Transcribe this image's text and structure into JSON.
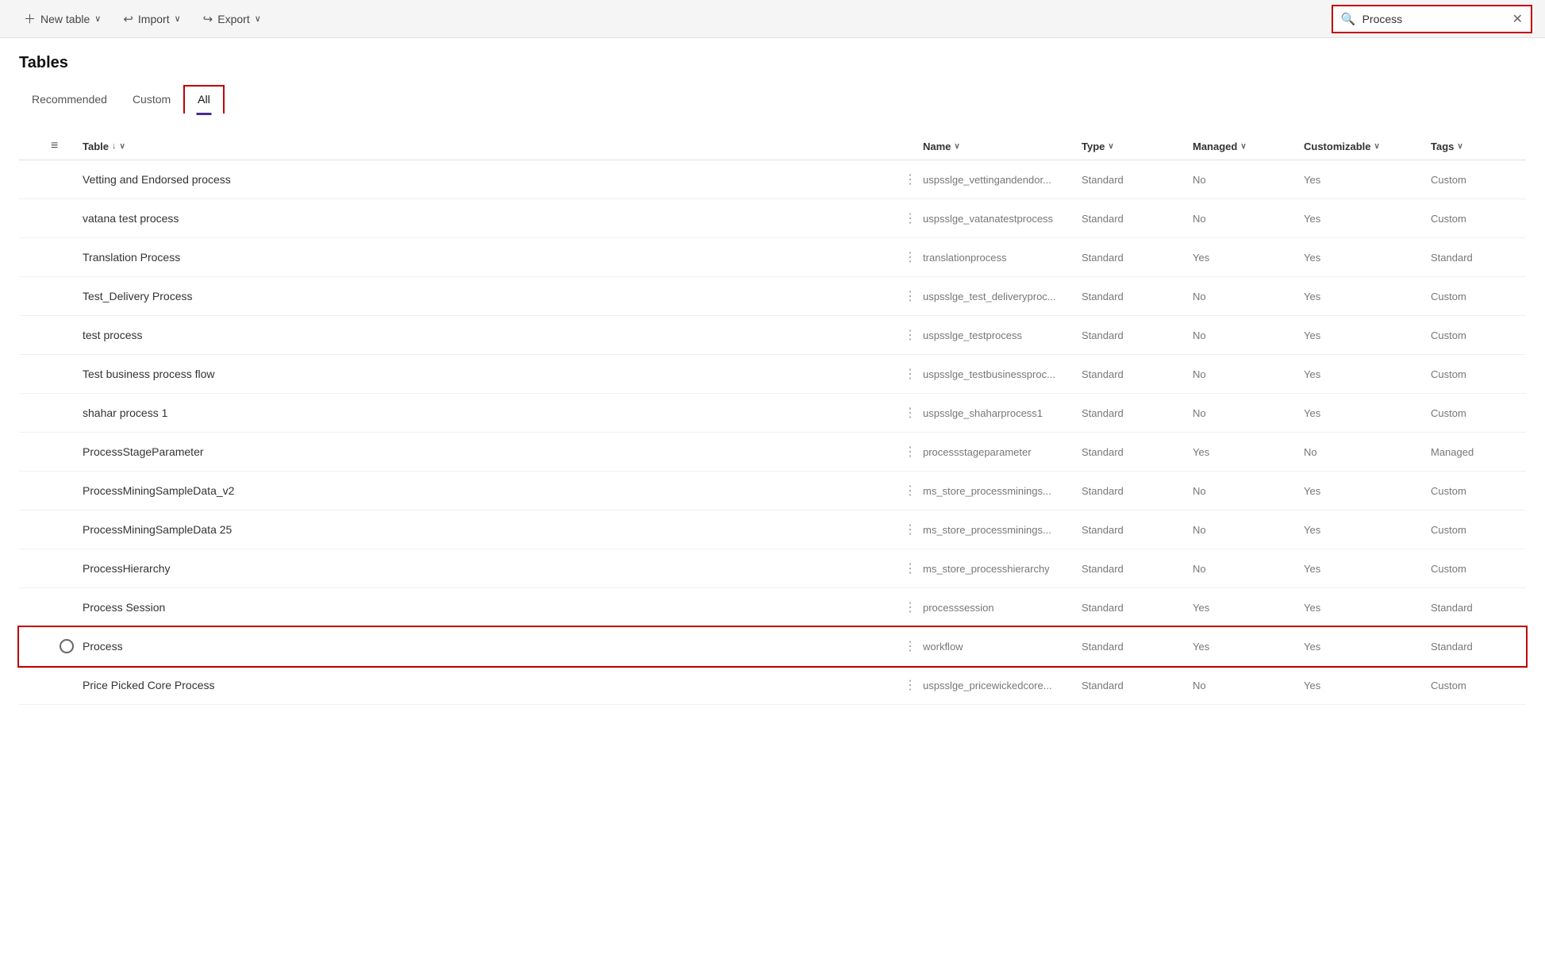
{
  "toolbar": {
    "new_table_label": "New table",
    "import_label": "Import",
    "export_label": "Export",
    "search_placeholder": "Process",
    "search_value": "Process"
  },
  "page": {
    "title": "Tables"
  },
  "tabs": [
    {
      "id": "recommended",
      "label": "Recommended",
      "active": false
    },
    {
      "id": "custom",
      "label": "Custom",
      "active": false
    },
    {
      "id": "all",
      "label": "All",
      "active": true
    }
  ],
  "table": {
    "columns": [
      {
        "id": "table",
        "label": "Table",
        "sort": "↓",
        "chevron": "∨"
      },
      {
        "id": "name",
        "label": "Name",
        "sort": "",
        "chevron": "∨"
      },
      {
        "id": "type",
        "label": "Type",
        "sort": "",
        "chevron": "∨"
      },
      {
        "id": "managed",
        "label": "Managed",
        "sort": "",
        "chevron": "∨"
      },
      {
        "id": "customizable",
        "label": "Customizable",
        "sort": "",
        "chevron": "∨"
      },
      {
        "id": "tags",
        "label": "Tags",
        "sort": "",
        "chevron": "∨"
      }
    ],
    "rows": [
      {
        "id": 1,
        "table": "Vetting and Endorsed process",
        "name": "uspsslge_vettingandendor...",
        "type": "Standard",
        "managed": "No",
        "customizable": "Yes",
        "tags": "Custom",
        "selected": false,
        "radio": false
      },
      {
        "id": 2,
        "table": "vatana test process",
        "name": "uspsslge_vatanatestprocess",
        "type": "Standard",
        "managed": "No",
        "customizable": "Yes",
        "tags": "Custom",
        "selected": false,
        "radio": false
      },
      {
        "id": 3,
        "table": "Translation Process",
        "name": "translationprocess",
        "type": "Standard",
        "managed": "Yes",
        "customizable": "Yes",
        "tags": "Standard",
        "selected": false,
        "radio": false
      },
      {
        "id": 4,
        "table": "Test_Delivery Process",
        "name": "uspsslge_test_deliveryproc...",
        "type": "Standard",
        "managed": "No",
        "customizable": "Yes",
        "tags": "Custom",
        "selected": false,
        "radio": false
      },
      {
        "id": 5,
        "table": "test process",
        "name": "uspsslge_testprocess",
        "type": "Standard",
        "managed": "No",
        "customizable": "Yes",
        "tags": "Custom",
        "selected": false,
        "radio": false
      },
      {
        "id": 6,
        "table": "Test business process flow",
        "name": "uspsslge_testbusinessproc...",
        "type": "Standard",
        "managed": "No",
        "customizable": "Yes",
        "tags": "Custom",
        "selected": false,
        "radio": false
      },
      {
        "id": 7,
        "table": "shahar process 1",
        "name": "uspsslge_shaharprocess1",
        "type": "Standard",
        "managed": "No",
        "customizable": "Yes",
        "tags": "Custom",
        "selected": false,
        "radio": false
      },
      {
        "id": 8,
        "table": "ProcessStageParameter",
        "name": "processstageparameter",
        "type": "Standard",
        "managed": "Yes",
        "customizable": "No",
        "tags": "Managed",
        "selected": false,
        "radio": false
      },
      {
        "id": 9,
        "table": "ProcessMiningSampleData_v2",
        "name": "ms_store_processminings...",
        "type": "Standard",
        "managed": "No",
        "customizable": "Yes",
        "tags": "Custom",
        "selected": false,
        "radio": false
      },
      {
        "id": 10,
        "table": "ProcessMiningSampleData 25",
        "name": "ms_store_processminings...",
        "type": "Standard",
        "managed": "No",
        "customizable": "Yes",
        "tags": "Custom",
        "selected": false,
        "radio": false
      },
      {
        "id": 11,
        "table": "ProcessHierarchy",
        "name": "ms_store_processhierarchy",
        "type": "Standard",
        "managed": "No",
        "customizable": "Yes",
        "tags": "Custom",
        "selected": false,
        "radio": false
      },
      {
        "id": 12,
        "table": "Process Session",
        "name": "processsession",
        "type": "Standard",
        "managed": "Yes",
        "customizable": "Yes",
        "tags": "Standard",
        "selected": false,
        "radio": false
      },
      {
        "id": 13,
        "table": "Process",
        "name": "workflow",
        "type": "Standard",
        "managed": "Yes",
        "customizable": "Yes",
        "tags": "Standard",
        "selected": true,
        "radio": true
      },
      {
        "id": 14,
        "table": "Price Picked Core Process",
        "name": "uspsslge_pricewickedcore...",
        "type": "Standard",
        "managed": "No",
        "customizable": "Yes",
        "tags": "Custom",
        "selected": false,
        "radio": false
      }
    ]
  }
}
